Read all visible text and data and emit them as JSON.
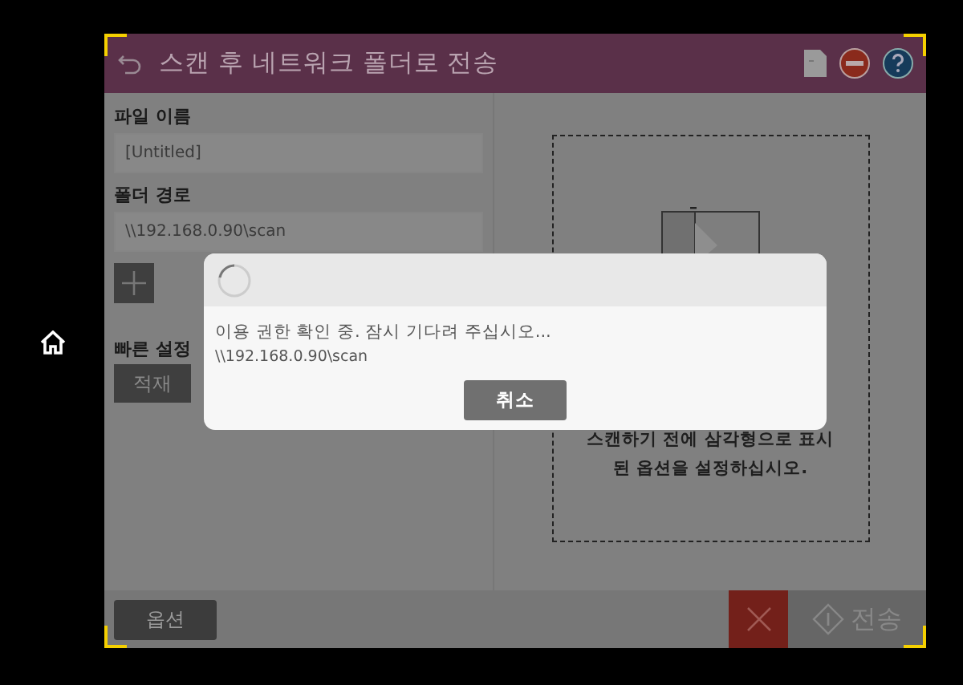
{
  "header": {
    "title": "스캔 후 네트워크 폴더로 전송"
  },
  "form": {
    "fields": [
      {
        "label": "파일 이름",
        "value": "[Untitled]"
      },
      {
        "label": "폴더 경로",
        "value": "\\\\192.168.0.90\\scan"
      }
    ],
    "quick_sets": {
      "label": "빠른 설정",
      "options": [
        "적재"
      ]
    }
  },
  "preview": {
    "hint": "스캔하기 전에 삼각형으로 표시\n된 옵션을 설정하십시오."
  },
  "dialog": {
    "message": "이용 권한 확인 중. 잠시 기다려 주십시오...",
    "path": "\\\\192.168.0.90\\scan",
    "button": "취소"
  },
  "bottom": {
    "options_button": "옵션",
    "send_button": "전송",
    "send_disabled": true
  }
}
